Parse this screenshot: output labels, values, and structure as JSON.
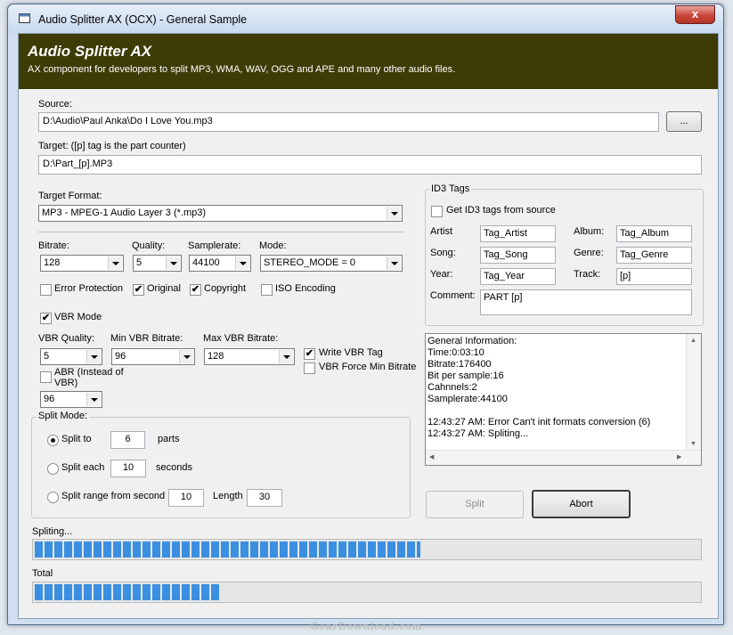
{
  "window": {
    "title": "Audio Splitter AX (OCX) - General Sample",
    "close_glyph": "x"
  },
  "banner": {
    "title": "Audio Splitter AX",
    "subtitle": "AX component for developers to split MP3, WMA, WAV, OGG and APE and many other audio files."
  },
  "source": {
    "label": "Source:",
    "value": "D:\\Audio\\Paul Anka\\Do I Love You.mp3",
    "browse_label": "..."
  },
  "target": {
    "label": "Target: ([p] tag is the part counter)",
    "value": "D:\\Part_[p].MP3"
  },
  "target_format": {
    "label": "Target Format:",
    "value": "MP3 - MPEG-1 Audio Layer 3 (*.mp3)"
  },
  "bitrate": {
    "label": "Bitrate:",
    "value": "128"
  },
  "quality": {
    "label": "Quality:",
    "value": "5"
  },
  "samplerate": {
    "label": "Samplerate:",
    "value": "44100"
  },
  "mode": {
    "label": "Mode:",
    "value": "STEREO_MODE = 0"
  },
  "flags": {
    "error_protection": {
      "label": "Error Protection",
      "checked": false
    },
    "original": {
      "label": "Original",
      "checked": true
    },
    "copyright": {
      "label": "Copyright",
      "checked": true
    },
    "iso_encoding": {
      "label": "ISO Encoding",
      "checked": false
    }
  },
  "vbr": {
    "mode_label": "VBR Mode",
    "mode_checked": true,
    "quality_label": "VBR Quality:",
    "quality_value": "5",
    "min_label": "Min VBR Bitrate:",
    "min_value": "96",
    "max_label": "Max VBR Bitrate:",
    "max_value": "128",
    "write_tag_label": "Write VBR Tag",
    "write_tag_checked": true,
    "force_min_label": "VBR Force Min Bitrate",
    "force_min_checked": false,
    "abr_label_1": "ABR (Instead of",
    "abr_label_2": "VBR)",
    "abr_checked": false,
    "abr_value": "96"
  },
  "split_mode": {
    "title": "Split Mode:",
    "split_to_label": "Split to",
    "split_to_value": "6",
    "split_to_unit": "parts",
    "split_each_label": "Split each",
    "split_each_value": "10",
    "split_each_unit": "seconds",
    "split_range_label": "Split range from second",
    "split_range_value": "10",
    "length_label": "Length",
    "length_value": "30",
    "selected": "split_to"
  },
  "id3": {
    "title": "ID3 Tags",
    "get_from_source_label": "Get ID3 tags from source",
    "get_from_source_checked": false,
    "artist_label": "Artist",
    "artist_value": "Tag_Artist",
    "album_label": "Album:",
    "album_value": "Tag_Album",
    "song_label": "Song:",
    "song_value": "Tag_Song",
    "genre_label": "Genre:",
    "genre_value": "Tag_Genre",
    "year_label": "Year:",
    "year_value": "Tag_Year",
    "track_label": "Track:",
    "track_value": "[p]",
    "comment_label": "Comment:",
    "comment_value": "PART [p]"
  },
  "info": {
    "lines": [
      "General Information:",
      "Time:0:03:10",
      "Bitrate:176400",
      "Bit per sample:16",
      "Cahnnels:2",
      "Samplerate:44100",
      "",
      "12:43:27 AM: Error Can't init formats conversion (6)",
      "12:43:27 AM: Spliting..."
    ]
  },
  "buttons": {
    "split_label": "Split",
    "abort_label": "Abort"
  },
  "progress": {
    "current_label": "Spliting...",
    "current_fraction": 0.58,
    "total_label": "Total",
    "total_fraction": 0.28
  },
  "watermark": "GearDownload.com",
  "colors": {
    "banner_bg": "#3d3b06",
    "progress_fill": "#3b8fe0",
    "close_button": "#c9463a"
  }
}
